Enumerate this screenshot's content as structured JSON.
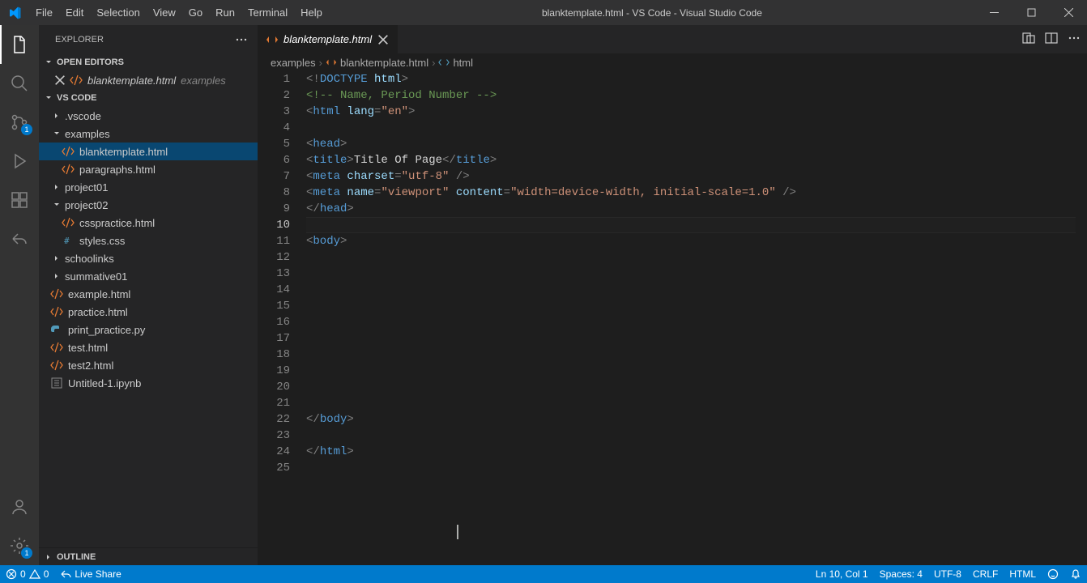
{
  "window": {
    "title": "blanktemplate.html - VS Code - Visual Studio Code",
    "menu": [
      "File",
      "Edit",
      "Selection",
      "View",
      "Go",
      "Run",
      "Terminal",
      "Help"
    ]
  },
  "activity": {
    "scm_badge": "1",
    "settings_badge": "1"
  },
  "sidebar": {
    "title": "EXPLORER",
    "sections": {
      "open_editors": "OPEN EDITORS",
      "workspace": "VS CODE",
      "outline": "OUTLINE"
    },
    "open_editors": [
      {
        "name": "blanktemplate.html",
        "desc": "examples",
        "icon": "html"
      }
    ],
    "tree": [
      {
        "type": "folder",
        "name": ".vscode",
        "depth": 0,
        "expanded": false
      },
      {
        "type": "folder",
        "name": "examples",
        "depth": 0,
        "expanded": true
      },
      {
        "type": "file",
        "name": "blanktemplate.html",
        "depth": 1,
        "icon": "html",
        "selected": true
      },
      {
        "type": "file",
        "name": "paragraphs.html",
        "depth": 1,
        "icon": "html"
      },
      {
        "type": "folder",
        "name": "project01",
        "depth": 0,
        "expanded": false
      },
      {
        "type": "folder",
        "name": "project02",
        "depth": 0,
        "expanded": true
      },
      {
        "type": "file",
        "name": "csspractice.html",
        "depth": 1,
        "icon": "html"
      },
      {
        "type": "file",
        "name": "styles.css",
        "depth": 1,
        "icon": "css"
      },
      {
        "type": "folder",
        "name": "schoolinks",
        "depth": 0,
        "expanded": false
      },
      {
        "type": "folder",
        "name": "summative01",
        "depth": 0,
        "expanded": false
      },
      {
        "type": "file",
        "name": "example.html",
        "depth": 0,
        "icon": "html"
      },
      {
        "type": "file",
        "name": "practice.html",
        "depth": 0,
        "icon": "html"
      },
      {
        "type": "file",
        "name": "print_practice.py",
        "depth": 0,
        "icon": "py"
      },
      {
        "type": "file",
        "name": "test.html",
        "depth": 0,
        "icon": "html"
      },
      {
        "type": "file",
        "name": "test2.html",
        "depth": 0,
        "icon": "html"
      },
      {
        "type": "file",
        "name": "Untitled-1.ipynb",
        "depth": 0,
        "icon": "nb"
      }
    ]
  },
  "tab": {
    "label": "blanktemplate.html"
  },
  "breadcrumbs": {
    "seg1": "examples",
    "seg2": "blanktemplate.html",
    "seg3": "html"
  },
  "code": {
    "lines": [
      [
        [
          "punct",
          "<!"
        ],
        [
          "doctype",
          "DOCTYPE"
        ],
        [
          "text",
          " "
        ],
        [
          "attr",
          "html"
        ],
        [
          "punct",
          ">"
        ]
      ],
      [
        [
          "comment",
          "<!-- Name, Period Number -->"
        ]
      ],
      [
        [
          "punct",
          "<"
        ],
        [
          "tag",
          "html"
        ],
        [
          "text",
          " "
        ],
        [
          "attr",
          "lang"
        ],
        [
          "punct",
          "="
        ],
        [
          "str",
          "\"en\""
        ],
        [
          "punct",
          ">"
        ]
      ],
      [],
      [
        [
          "punct",
          "<"
        ],
        [
          "tag",
          "head"
        ],
        [
          "punct",
          ">"
        ]
      ],
      [
        [
          "punct",
          "<"
        ],
        [
          "tag",
          "title"
        ],
        [
          "punct",
          ">"
        ],
        [
          "text",
          "Title Of Page"
        ],
        [
          "punct",
          "</"
        ],
        [
          "tag",
          "title"
        ],
        [
          "punct",
          ">"
        ]
      ],
      [
        [
          "punct",
          "<"
        ],
        [
          "tag",
          "meta"
        ],
        [
          "text",
          " "
        ],
        [
          "attr",
          "charset"
        ],
        [
          "punct",
          "="
        ],
        [
          "str",
          "\"utf-8\""
        ],
        [
          "text",
          " "
        ],
        [
          "punct",
          "/>"
        ]
      ],
      [
        [
          "punct",
          "<"
        ],
        [
          "tag",
          "meta"
        ],
        [
          "text",
          " "
        ],
        [
          "attr",
          "name"
        ],
        [
          "punct",
          "="
        ],
        [
          "str",
          "\"viewport\""
        ],
        [
          "text",
          " "
        ],
        [
          "attr",
          "content"
        ],
        [
          "punct",
          "="
        ],
        [
          "str",
          "\"width=device-width, initial-scale=1.0\""
        ],
        [
          "text",
          " "
        ],
        [
          "punct",
          "/>"
        ]
      ],
      [
        [
          "punct",
          "</"
        ],
        [
          "tag",
          "head"
        ],
        [
          "punct",
          ">"
        ]
      ],
      [],
      [
        [
          "punct",
          "<"
        ],
        [
          "tag",
          "body"
        ],
        [
          "punct",
          ">"
        ]
      ],
      [],
      [],
      [],
      [],
      [],
      [],
      [],
      [],
      [],
      [],
      [
        [
          "punct",
          "</"
        ],
        [
          "tag",
          "body"
        ],
        [
          "punct",
          ">"
        ]
      ],
      [],
      [
        [
          "punct",
          "</"
        ],
        [
          "tag",
          "html"
        ],
        [
          "punct",
          ">"
        ]
      ],
      []
    ],
    "current_line_index": 9
  },
  "status": {
    "errors": "0",
    "warnings": "0",
    "liveshare": "Live Share",
    "position": "Ln 10, Col 1",
    "spaces": "Spaces: 4",
    "encoding": "UTF-8",
    "eol": "CRLF",
    "lang": "HTML"
  }
}
